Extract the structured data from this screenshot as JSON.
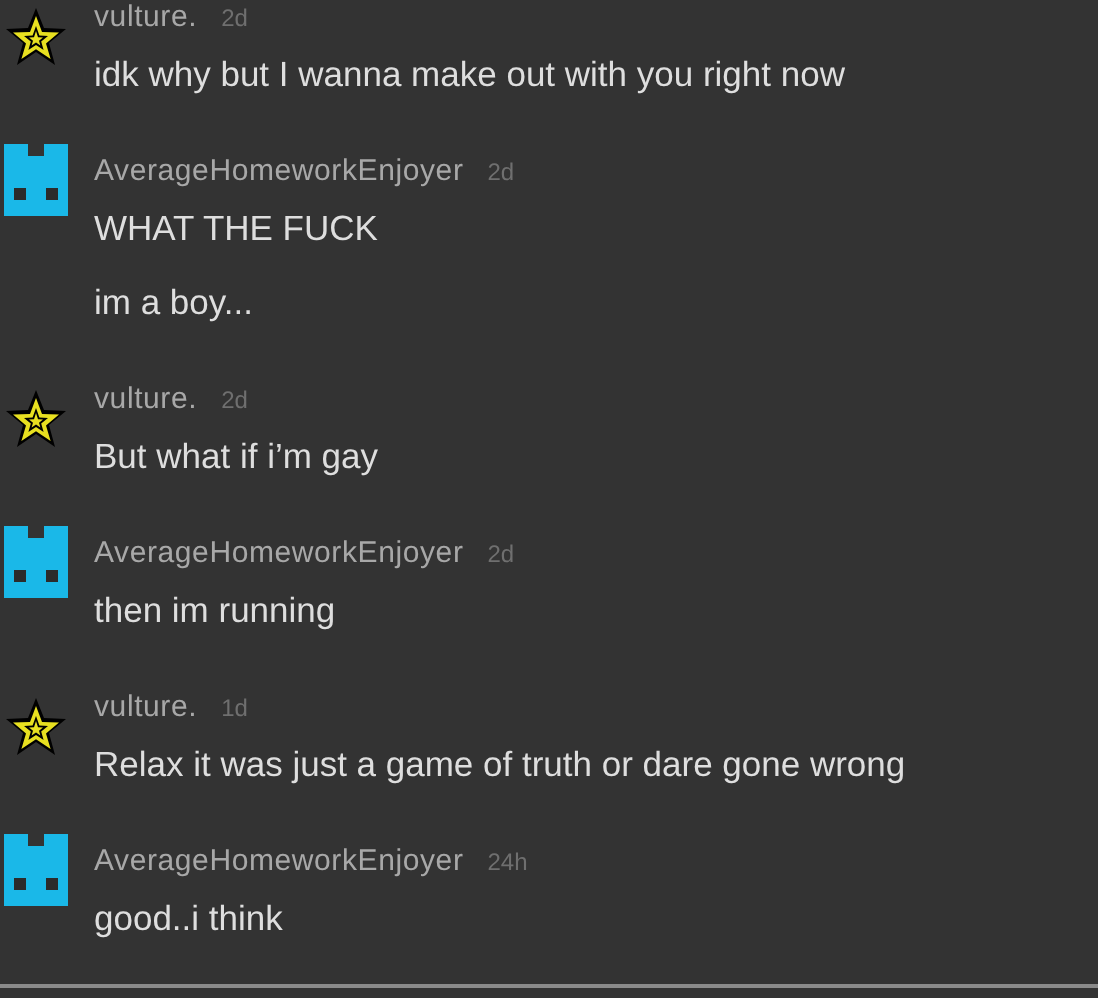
{
  "messages": [
    {
      "author": "vulture.",
      "time": "2d",
      "kind": "star",
      "lines": [
        "idk why but I wanna make out with you right now"
      ]
    },
    {
      "author": "AverageHomeworkEnjoyer",
      "time": "2d",
      "kind": "blocks",
      "lines": [
        "WHAT THE FUCK",
        "im a boy..."
      ]
    },
    {
      "author": "vulture.",
      "time": "2d",
      "kind": "star",
      "lines": [
        "But what if i’m gay"
      ]
    },
    {
      "author": "AverageHomeworkEnjoyer",
      "time": "2d",
      "kind": "blocks",
      "lines": [
        "then im running"
      ]
    },
    {
      "author": "vulture.",
      "time": "1d",
      "kind": "star",
      "lines": [
        "Relax it was just a game of truth or dare gone wrong"
      ]
    },
    {
      "author": "AverageHomeworkEnjoyer",
      "time": "24h",
      "kind": "blocks",
      "lines": [
        "good..i think"
      ]
    }
  ]
}
